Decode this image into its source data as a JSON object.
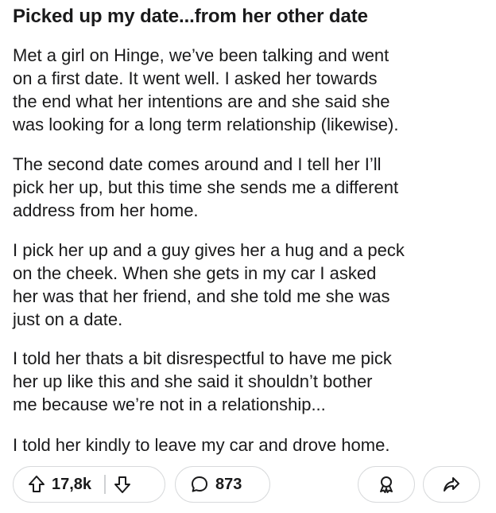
{
  "post": {
    "title": "Picked up my date...from her other date",
    "paragraphs": [
      {
        "lines": [
          "Met a girl on Hinge, we’ve been talking and went",
          "on a first date. It went well. I asked her towards",
          "the end what her intentions are and she said she",
          "was looking for a long term relationship (likewise)."
        ]
      },
      {
        "lines": [
          "The second date comes around and I tell her I’ll",
          "pick her up, but this time she sends me a different",
          "address from her home."
        ]
      },
      {
        "lines": [
          "I pick her up and a guy gives her a hug and a peck",
          "on the cheek. When she gets in my car I asked",
          "her was that her friend, and she told me she was",
          "just on a date."
        ]
      },
      {
        "lines": [
          "I told her thats a bit disrespectful to have me pick",
          "her up like this and she said it shouldn’t bother",
          "me because we’re not in a relationship..."
        ]
      },
      {
        "lines": [
          "I told her kindly to leave my car and drove home."
        ]
      }
    ]
  },
  "actions": {
    "upvote_icon": "arrow-up-icon",
    "vote_count": "17,8k",
    "downvote_icon": "arrow-down-icon",
    "comment_icon": "speech-bubble-icon",
    "comment_count": "873",
    "award_icon": "award-ribbon-icon",
    "share_icon": "share-arrow-icon"
  },
  "colors": {
    "text": "#1a1a1b",
    "pill_border": "#d8dadc",
    "background": "#ffffff"
  }
}
